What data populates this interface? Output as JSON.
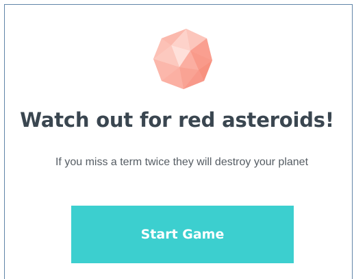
{
  "header": {
    "icon": "red-asteroid-icon",
    "title": "Watch out for red asteroids!",
    "subtitle": "If you miss a term twice they will destroy your planet"
  },
  "actions": {
    "start_label": "Start Game"
  },
  "colors": {
    "button": "#3ccfcf",
    "asteroid": "#fba89a",
    "title": "#3a4650"
  }
}
